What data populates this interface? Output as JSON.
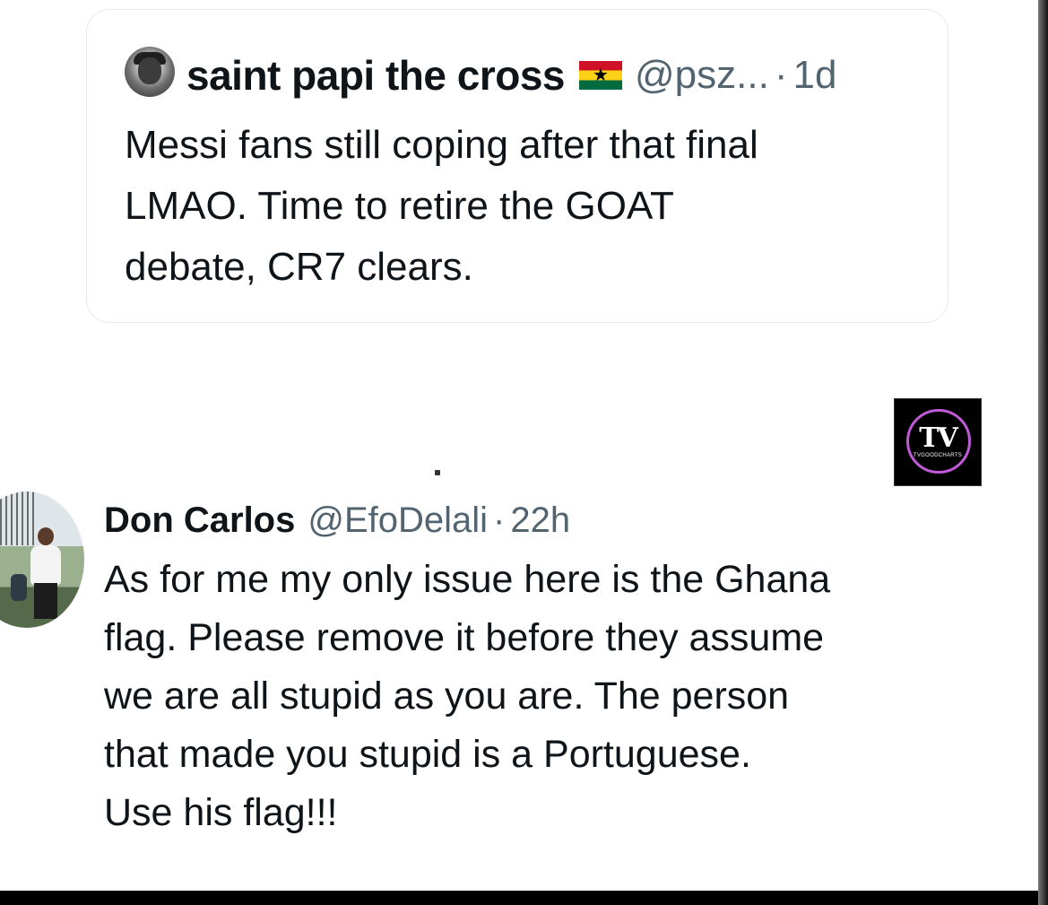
{
  "quoted_tweet": {
    "author_name": "saint papi the cross",
    "flag_emoji": "🇬🇭",
    "handle": "@psz...",
    "separator": "·",
    "time": "1d",
    "text": "Messi fans still coping after that final\nLMAO. Time to retire the GOAT\ndebate, CR7 clears."
  },
  "reply_tweet": {
    "author_name": "Don Carlos",
    "handle": "@EfoDelali",
    "separator": "·",
    "time": "22h",
    "text": "As for me my only issue here is the Ghana\nflag. Please remove it before they assume\nwe are all stupid as you are. The person\nthat made you stupid is a Portuguese.\nUse his flag!!!"
  },
  "watermark": {
    "letters": "TV",
    "subtext": "TVGOODCHARTS"
  },
  "colors": {
    "text_primary": "#0f1419",
    "text_secondary": "#536471",
    "card_border": "#e6e9ec",
    "ghana_red": "#ce1126",
    "ghana_gold": "#fcd116",
    "ghana_green": "#006b3f",
    "watermark_ring": "#c05ad6"
  }
}
